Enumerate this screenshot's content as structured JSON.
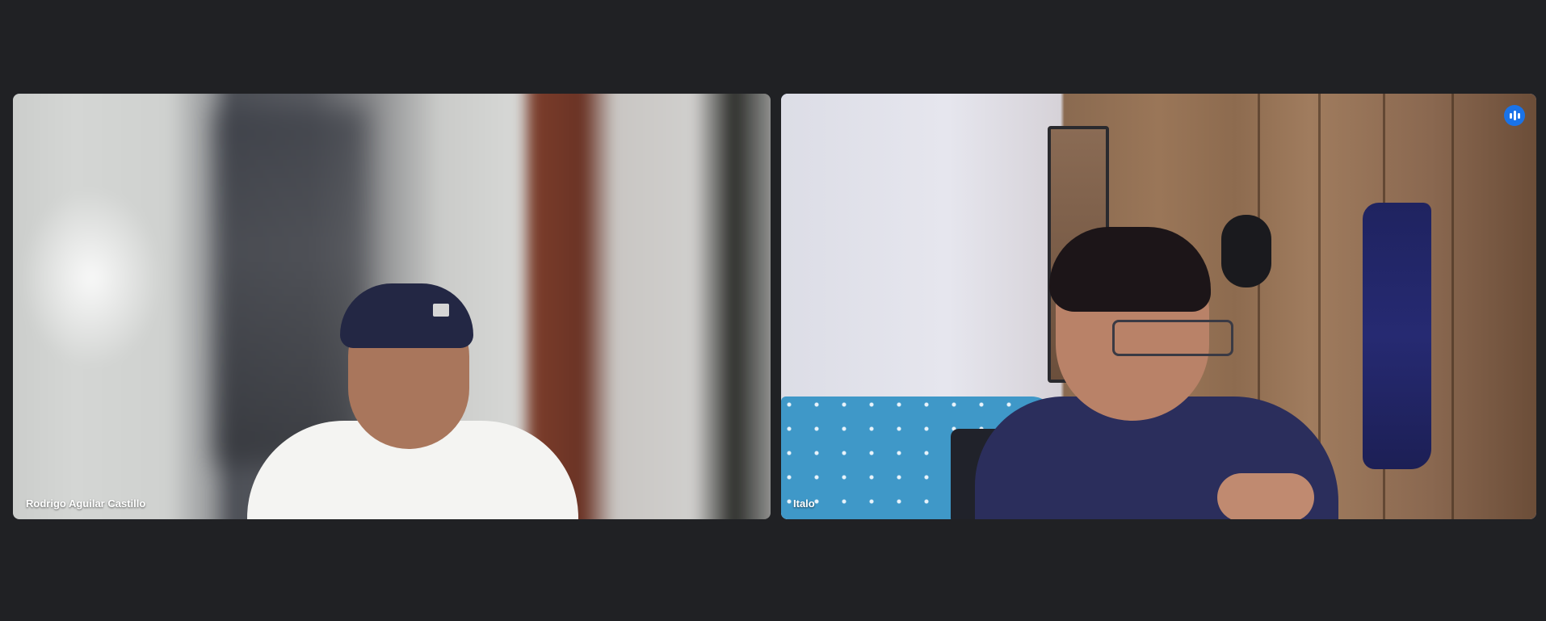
{
  "meeting": {
    "layout": "tiled-two-participants",
    "background_color": "#202124",
    "accent_color": "#8ab4f8"
  },
  "participants": [
    {
      "name": "Rodrigo Aguilar Castillo",
      "speaking": false
    },
    {
      "name": "Italo",
      "speaking": true,
      "indicator_icon": "audio-level-icon",
      "indicator_color": "#1a73e8"
    }
  ]
}
